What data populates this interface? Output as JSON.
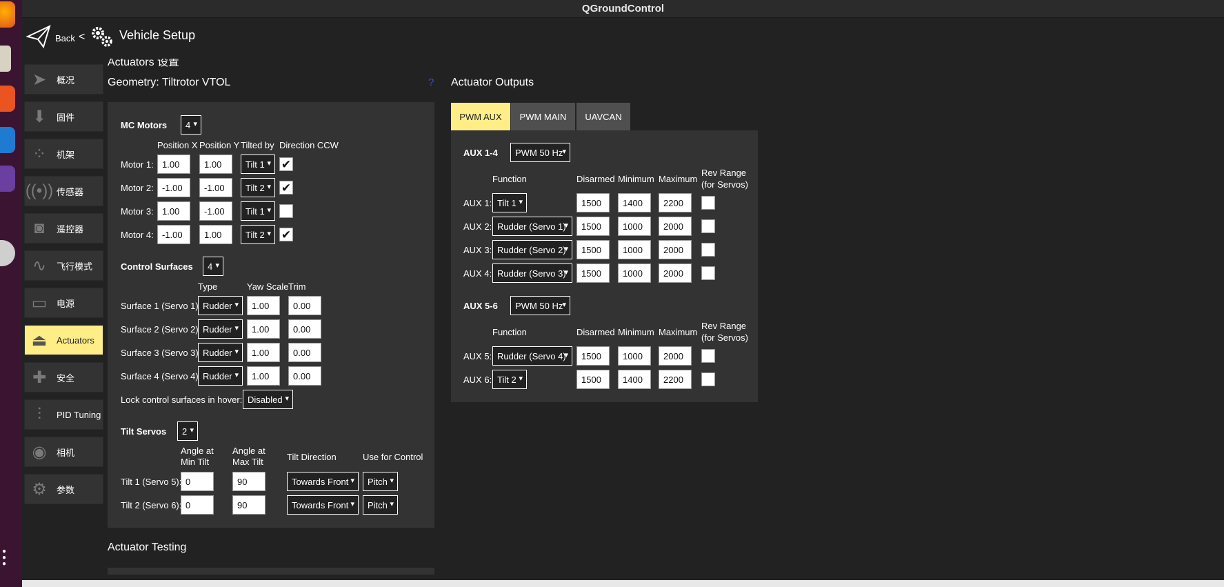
{
  "window": {
    "title": "QGroundControl"
  },
  "header": {
    "back_label": "Back",
    "back_sep": "<",
    "title": "Vehicle Setup"
  },
  "sidebar": {
    "items": [
      {
        "label": "概况",
        "icon": "paper-plane-icon"
      },
      {
        "label": "固件",
        "icon": "download-icon"
      },
      {
        "label": "机架",
        "icon": "airframe-dots-icon"
      },
      {
        "label": "传感器",
        "icon": "radio-waves-icon"
      },
      {
        "label": "遥控器",
        "icon": "rc-transmitter-icon"
      },
      {
        "label": "飞行模式",
        "icon": "wave-icon"
      },
      {
        "label": "电源",
        "icon": "battery-icon"
      },
      {
        "label": "Actuators",
        "icon": "actuator-icon"
      },
      {
        "label": "安全",
        "icon": "first-aid-icon"
      },
      {
        "label": "PID Tuning",
        "icon": "sliders-icon"
      },
      {
        "label": "相机",
        "icon": "camera-icon"
      },
      {
        "label": "参数",
        "icon": "gears-icon"
      }
    ]
  },
  "geometry": {
    "clipped_heading": "Actuators 设置",
    "title": "Geometry: Tiltrotor VTOL",
    "help_link": "?",
    "mc_motors": {
      "label": "MC Motors",
      "count": "4",
      "headers": [
        "Position X",
        "Position Y",
        "Tilted by",
        "Direction CCW"
      ],
      "rows": [
        {
          "label": "Motor 1:",
          "x": "1.00",
          "y": "1.00",
          "tilt": "Tilt 1",
          "ccw": "✔"
        },
        {
          "label": "Motor 2:",
          "x": "-1.00",
          "y": "-1.00",
          "tilt": "Tilt 2",
          "ccw": "✔"
        },
        {
          "label": "Motor 3:",
          "x": "1.00",
          "y": "-1.00",
          "tilt": "Tilt 1",
          "ccw": ""
        },
        {
          "label": "Motor 4:",
          "x": "-1.00",
          "y": "1.00",
          "tilt": "Tilt 2",
          "ccw": "✔"
        }
      ]
    },
    "control_surfaces": {
      "label": "Control Surfaces",
      "count": "4",
      "headers": [
        "Type",
        "Yaw Scale",
        "Trim"
      ],
      "rows": [
        {
          "label": "Surface 1 (Servo 1):",
          "type": "Rudder",
          "yaw": "1.00",
          "trim": "0.00"
        },
        {
          "label": "Surface 2 (Servo 2):",
          "type": "Rudder",
          "yaw": "1.00",
          "trim": "0.00"
        },
        {
          "label": "Surface 3 (Servo 3):",
          "type": "Rudder",
          "yaw": "1.00",
          "trim": "0.00"
        },
        {
          "label": "Surface 4 (Servo 4):",
          "type": "Rudder",
          "yaw": "1.00",
          "trim": "0.00"
        }
      ],
      "lock_label": "Lock control surfaces in hover:",
      "lock_value": "Disabled"
    },
    "tilt_servos": {
      "label": "Tilt Servos",
      "count": "2",
      "headers": [
        "Angle at Min Tilt",
        "Angle at Max Tilt",
        "Tilt Direction",
        "Use for Control"
      ],
      "rows": [
        {
          "label": "Tilt 1 (Servo 5):",
          "min": "0",
          "max": "90",
          "dir": "Towards Front",
          "use": "Pitch"
        },
        {
          "label": "Tilt 2 (Servo 6):",
          "min": "0",
          "max": "90",
          "dir": "Towards Front",
          "use": "Pitch"
        }
      ]
    }
  },
  "actuator_testing": {
    "title": "Actuator Testing"
  },
  "outputs": {
    "title": "Actuator Outputs",
    "tabs": [
      "PWM AUX",
      "PWM MAIN",
      "UAVCAN"
    ],
    "active_tab": "PWM AUX",
    "groups": [
      {
        "label": "AUX 1-4",
        "rate": "PWM 50 Hz",
        "headers": [
          "Function",
          "Disarmed",
          "Minimum",
          "Maximum",
          "Rev Range",
          "(for Servos)"
        ],
        "rows": [
          {
            "label": "AUX 1:",
            "func": "Tilt 1",
            "disarmed": "1500",
            "min": "1400",
            "max": "2200"
          },
          {
            "label": "AUX 2:",
            "func": "Rudder (Servo 1)",
            "disarmed": "1500",
            "min": "1000",
            "max": "2000"
          },
          {
            "label": "AUX 3:",
            "func": "Rudder (Servo 2)",
            "disarmed": "1500",
            "min": "1000",
            "max": "2000"
          },
          {
            "label": "AUX 4:",
            "func": "Rudder (Servo 3)",
            "disarmed": "1500",
            "min": "1000",
            "max": "2000"
          }
        ]
      },
      {
        "label": "AUX 5-6",
        "rate": "PWM 50 Hz",
        "headers": [
          "Function",
          "Disarmed",
          "Minimum",
          "Maximum",
          "Rev Range",
          "(for Servos)"
        ],
        "rows": [
          {
            "label": "AUX 5:",
            "func": "Rudder (Servo 4)",
            "disarmed": "1500",
            "min": "1000",
            "max": "2000"
          },
          {
            "label": "AUX 6:",
            "func": "Tilt 2",
            "disarmed": "1500",
            "min": "1400",
            "max": "2200"
          }
        ]
      }
    ]
  },
  "colors": {
    "accent": "#ffee88",
    "panel": "#333333",
    "background": "#222222",
    "dock": "#3a1430"
  }
}
